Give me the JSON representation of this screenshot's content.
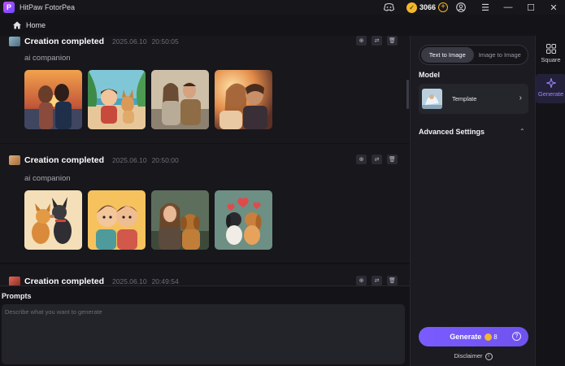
{
  "app": {
    "title": "HitPaw FotorPea",
    "logo": "P",
    "coins": "3066"
  },
  "breadcrumb": {
    "home": "Home"
  },
  "cards": [
    {
      "title": "Creation completed",
      "date": "2025.06.10",
      "time": "20:50:05",
      "prompt": "ai companion",
      "thumb_color": "#7aa9c4",
      "images": [
        "couple-sunset",
        "boy-and-dog-beach",
        "couple-on-couch",
        "couple-kiss-sunset"
      ]
    },
    {
      "title": "Creation completed",
      "date": "2025.06.10",
      "time": "20:50:00",
      "prompt": "ai companion",
      "thumb_color": "#d8a36a",
      "images": [
        "cartoon-dogs-kissing",
        "cartoon-boys-hug",
        "woman-with-dog",
        "cartoon-dogs-hearts"
      ]
    },
    {
      "title": "Creation completed",
      "date": "2025.06.10",
      "time": "20:49:54",
      "prompt": "",
      "thumb_color": "#c9443a",
      "images": []
    }
  ],
  "prompts": {
    "label": "Prompts",
    "placeholder": "Describe what you want to generate"
  },
  "panel": {
    "tabs": [
      {
        "label": "Text to Image",
        "active": true
      },
      {
        "label": "Image to Image",
        "active": false
      }
    ],
    "model_label": "Model",
    "model_name": "Template",
    "advanced_label": "Advanced Settings",
    "generate_label": "Generate",
    "generate_cost": "8",
    "disclaimer": "Disclaimer"
  },
  "rail": [
    {
      "label": "Square",
      "active": false
    },
    {
      "label": "Generate",
      "active": true
    }
  ],
  "colors": {
    "accent": "#7a5cff",
    "coin": "#f3b72b",
    "background": "#121215"
  }
}
